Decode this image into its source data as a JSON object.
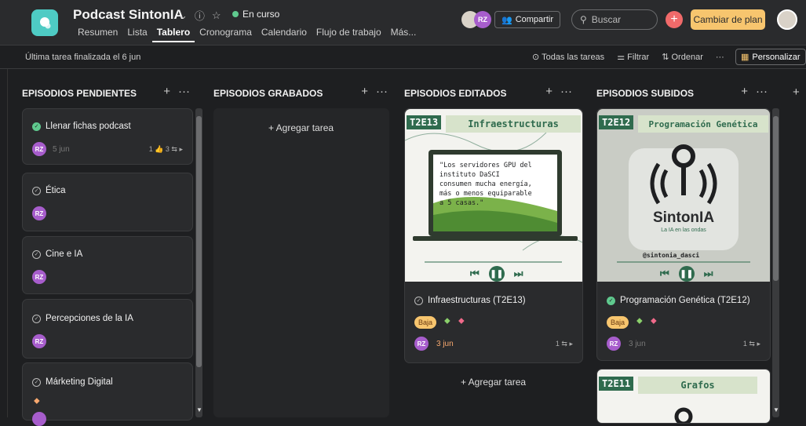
{
  "project": {
    "title": "Podcast SintonIA",
    "status": "En curso",
    "tabs": [
      "Resumen",
      "Lista",
      "Tablero",
      "Cronograma",
      "Calendario",
      "Flujo de trabajo",
      "Más..."
    ]
  },
  "header": {
    "avatar_initials": "RZ",
    "share_label": "Compartir",
    "search_placeholder": "Buscar",
    "upgrade_label": "Cambiar de plan"
  },
  "subbar": {
    "last_task": "Última tarea finalizada el 6 jun",
    "all_tasks": "Todas las tareas",
    "filter": "Filtrar",
    "sort": "Ordenar",
    "more": "···",
    "customize": "Personalizar"
  },
  "columns": [
    {
      "title": "EPISODIOS PENDIENTES",
      "cards": [
        {
          "title": "Llenar fichas podcast",
          "avatar": "RZ",
          "date": "5 jun",
          "meta": "1 👍 3 ⇆ ▸",
          "done": true
        },
        {
          "title": "Ética",
          "avatar": "RZ"
        },
        {
          "title": "Cine e IA",
          "avatar": "RZ"
        },
        {
          "title": "Percepciones de la IA",
          "avatar": "RZ"
        },
        {
          "title": "Márketing Digital"
        }
      ]
    },
    {
      "title": "EPISODIOS GRABADOS",
      "add_task": "+ Agregar tarea"
    },
    {
      "title": "EPISODIOS EDITADOS",
      "cards": [
        {
          "code": "T2E13",
          "cover_title": "Infraestructuras",
          "quote": "\"Los servidores GPU del instituto DaSCI consumen mucha energía, más o menos equiparable a 5 casas.\"",
          "title": "Infraestructuras (T2E13)",
          "priority": "Baja",
          "avatar": "RZ",
          "date": "3 jun",
          "meta": "1 ⇆ ▸"
        }
      ],
      "add_task": "+ Agregar tarea"
    },
    {
      "title": "EPISODIOS SUBIDOS",
      "cards": [
        {
          "code": "T2E12",
          "cover_title": "Programación Genética",
          "logo": "SintonIA",
          "logo_sub": "La IA en las ondas",
          "handle": "@sintonia_dasci",
          "title": "Programación Genética (T2E12)",
          "priority": "Baja",
          "avatar": "RZ",
          "date": "3 jun",
          "meta": "1 ⇆ ▸",
          "done": true
        },
        {
          "code": "T2E11",
          "cover_title": "Grafos"
        }
      ]
    }
  ],
  "colors": {
    "bg": "#1e1f21",
    "card": "#2a2b2d",
    "accent_green": "#2f6b4e",
    "badge": "#f7c56e"
  }
}
